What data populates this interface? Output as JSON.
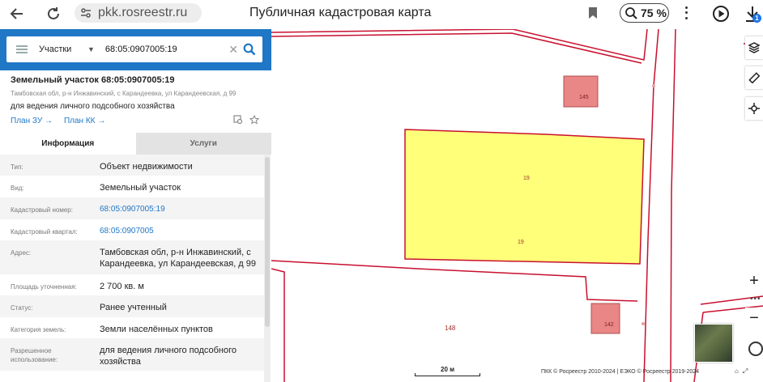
{
  "browser": {
    "url": "pkk.rosreestr.ru",
    "page_title": "Публичная кадастровая карта",
    "zoom": "75 %",
    "download_badge": "1"
  },
  "search": {
    "category": "Участки",
    "query": "68:05:0907005:19"
  },
  "object": {
    "title": "Земельный участок 68:05:0907005:19",
    "address_line": "Тамбовская обл, р-н Инжавинский, с Карандеевка, ул Карандеевская, д 99",
    "use_line": "для ведения личного подсобного хозяйства",
    "plan_zu": "План ЗУ →",
    "plan_kk": "План КК →"
  },
  "tabs": [
    {
      "label": "Информация",
      "active": true
    },
    {
      "label": "Услуги",
      "active": false
    }
  ],
  "info_rows": [
    {
      "label": "Тип:",
      "value": "Объект недвижимости",
      "link": false
    },
    {
      "label": "Вид:",
      "value": "Земельный участок",
      "link": false
    },
    {
      "label": "Кадастровый номер:",
      "value": "68:05:0907005:19",
      "link": true
    },
    {
      "label": "Кадастровый квартал:",
      "value": "68:05:0907005",
      "link": true
    },
    {
      "label": "Адрес:",
      "value": "Тамбовская обл, р-н Инжавинский, с Карандеевка, ул Карандеевская, д 99",
      "link": false
    },
    {
      "label": "Площадь уточненная:",
      "value": "2 700 кв. м",
      "link": false
    },
    {
      "label": "Статус:",
      "value": "Ранее учтенный",
      "link": false
    },
    {
      "label": "Категория земель:",
      "value": "Земли населённых пунктов",
      "link": false
    },
    {
      "label": "Разрешенное использование:",
      "value": "для ведения личного подсобного хозяйства",
      "link": false
    }
  ],
  "map": {
    "parcel_label_top": "19",
    "parcel_label_bottom": "19",
    "building_145": "145",
    "building_142": "142",
    "parcel_148": "148",
    "scale": "20 м",
    "footer": "ПКК © Росреестр 2010-2024 | ЕЭКО © Росреестр 2019-2024",
    "colors": {
      "boundary": "#c8102e",
      "selected_fill": "#ffff7a",
      "building_fill": "#e98686"
    }
  }
}
